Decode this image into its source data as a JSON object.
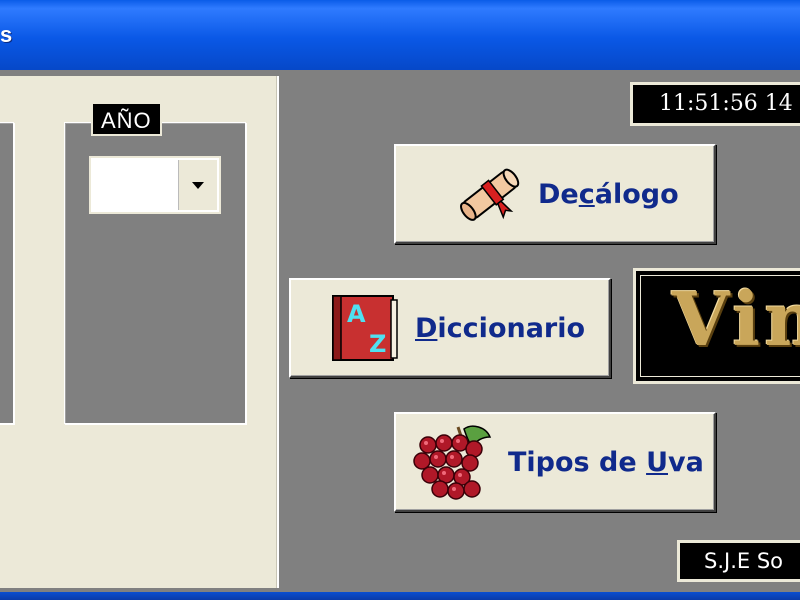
{
  "window": {
    "title": "s"
  },
  "year_filter": {
    "label": "AÑO",
    "selected": ""
  },
  "clock": {
    "time": "11:51:56  14"
  },
  "buttons": {
    "decalogo": {
      "pre": "De",
      "accel": "c",
      "post": "álogo",
      "icon": "diploma-scroll-icon"
    },
    "diccionario": {
      "pre": "",
      "accel": "D",
      "post": "iccionario",
      "icon": "dictionary-book-icon"
    },
    "tipos_uva": {
      "pre": "Tipos de ",
      "accel": "U",
      "post": "va",
      "icon": "grapes-icon"
    }
  },
  "logo": {
    "text": "Vin"
  },
  "footer": {
    "text": "S.J.E So"
  },
  "colors": {
    "titlebar": "#0a58e6",
    "panel": "#ece9d8",
    "background": "#808080",
    "button_text": "#102a8c"
  }
}
